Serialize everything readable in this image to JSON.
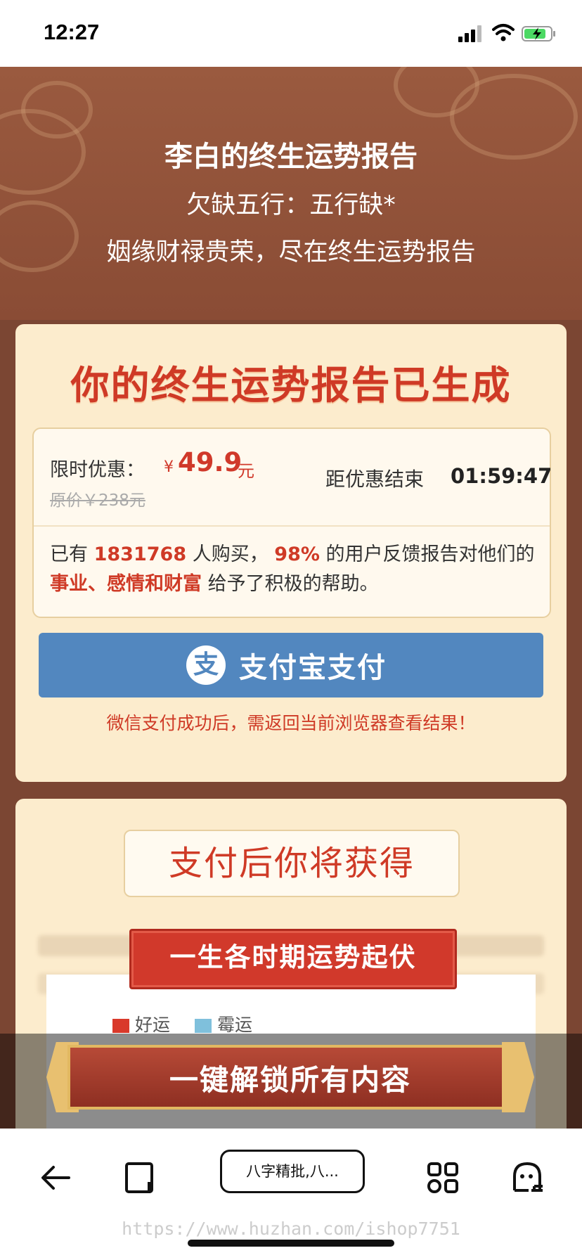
{
  "status_bar": {
    "time": "12:27"
  },
  "hero": {
    "title": "李白的终生运势报告",
    "subtitle1": "欠缺五行：五行缺*",
    "subtitle2": "姻缘财禄贵荣，尽在终生运势报告"
  },
  "report_card": {
    "headline": "你的终生运势报告已生成",
    "offer_label": "限时优惠：",
    "currency_symbol": "¥",
    "price": "49.9",
    "price_unit": "元",
    "original_price": "原价￥238元",
    "countdown_label": "距优惠结束",
    "countdown": "01:59:47",
    "desc_prefix": "已有",
    "buyers": "1831768",
    "desc_mid1": "人购买，",
    "percent": "98%",
    "desc_mid2": "的用户反馈报告对他们的",
    "highlight": "事业、感情和财富",
    "desc_suffix": "给予了积极的帮助。",
    "pay_button_icon": "支",
    "pay_button": "支付宝支付",
    "notice": "微信支付成功后，需返回当前浏览器查看结果！"
  },
  "benefits_card": {
    "heading": "支付后你将获得",
    "section_title": "一生各时期运势起伏",
    "legend": [
      {
        "label": "好运",
        "color": "#d9392b"
      },
      {
        "label": "霉运",
        "color": "#7fc0dc"
      }
    ]
  },
  "unlock_button": "一键解锁所有内容",
  "browser": {
    "tab_title": "八字精批,八...",
    "icons": [
      "back-arrow-icon",
      "tabs-icon",
      "apps-grid-icon",
      "ghost-menu-icon"
    ]
  },
  "watermark": "https://www.huzhan.com/ishop7751"
}
